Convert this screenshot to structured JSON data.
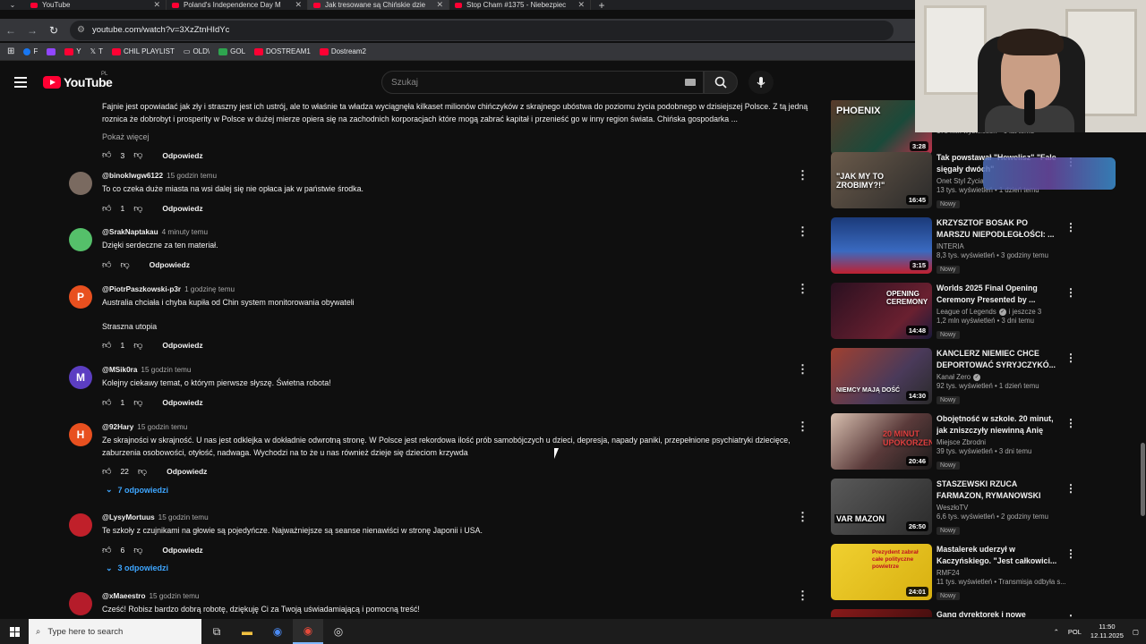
{
  "browser": {
    "tabs": [
      {
        "title": "YouTube",
        "active": false
      },
      {
        "title": "Poland's Independence Day M",
        "active": false
      },
      {
        "title": "Jak tresowane są Chińskie dzie",
        "active": true
      },
      {
        "title": "Stop Cham #1375 - Niebezpiec",
        "active": false
      }
    ],
    "url": "youtube.com/watch?v=3XzZtnHIdYc",
    "bookmarks": [
      {
        "label": "F",
        "color": "#1877f2"
      },
      {
        "label": "",
        "color": "#9146ff"
      },
      {
        "label": "Y",
        "color": "#ff0033"
      },
      {
        "label": "T",
        "color": "#ffffff"
      },
      {
        "label": "CHIL PLAYLIST",
        "color": "#ff0033"
      },
      {
        "label": "OLD\\",
        "color": "#cccccc"
      },
      {
        "label": "GOL",
        "color": "#2ea44f"
      },
      {
        "label": "DOSTREAM1",
        "color": "#ff0033"
      },
      {
        "label": "Dostream2",
        "color": "#ff0033"
      }
    ]
  },
  "youtube": {
    "logo_text": "YouTube",
    "country_code": "PL",
    "search_placeholder": "Szukaj"
  },
  "comments": {
    "prev_text": "Fajnie jest opowiadać jak zły i straszny jest ich ustrój, ale to właśnie ta władza wyciągnęła kilkaset milionów chińczyków z skrajnego ubóstwa do poziomu życia podobnego w dzisiejszej Polsce. Z tą jedną roznica że dobrobyt i prosperity w Polsce w dużej mierze opiera się na zachodnich korporacjach które mogą zabrać kapitał i przenieść go w inny region świata. Chińska gospodarka ...",
    "show_more": "Pokaż więcej",
    "prev_likes": "3",
    "reply_label": "Odpowiedz",
    "items": [
      {
        "author": "@binoklwgw6122",
        "time": "15 godzin temu",
        "text": "To co czeka duże miasta na wsi dalej się nie opłaca jak w państwie środka.",
        "likes": "1",
        "avatar_letter": "",
        "avatar_color": "#7a6a60"
      },
      {
        "author": "@SrakNaptakau",
        "time": "4 minuty temu",
        "text": "Dzięki serdeczne za ten materiał.",
        "likes": "",
        "avatar_letter": "",
        "avatar_color": "#55c06a"
      },
      {
        "author": "@PiotrPaszkowski-p3r",
        "time": "1 godzinę temu",
        "text": "Australia chciała i chyba kupiła od Chin system monitorowania obywateli",
        "text2": "Straszna utopia",
        "likes": "1",
        "avatar_letter": "P",
        "avatar_color": "#e8501f"
      },
      {
        "author": "@MSik0ra",
        "time": "15 godzin temu",
        "text": "Kolejny ciekawy temat, o którym pierwsze słyszę. Świetna robota!",
        "likes": "1",
        "avatar_letter": "M",
        "avatar_color": "#5c3ec2"
      },
      {
        "author": "@92Hary",
        "time": "15 godzin temu",
        "text": "Ze skrajności w skrajność. U nas jest odklejka w dokładnie odwrotną stronę. W Polsce jest rekordowa ilość prób samobójczych u dzieci, depresja, napady paniki, przepełnione psychiatryki dziecięce, zaburzenia osobowości, otyłość, nadwaga. Wychodzi na to że u nas również dzieje się dzieciom krzywda",
        "likes": "22",
        "avatar_letter": "H",
        "avatar_color": "#e8501f",
        "replies": "7 odpowiedzi"
      },
      {
        "author": "@LysyMortuus",
        "time": "15 godzin temu",
        "text": "Te szkoły z czujnikami na głowie są pojedyńcze. Najważniejsze są seanse nienawiści w stronę Japonii i USA.",
        "likes": "6",
        "avatar_letter": "",
        "avatar_color": "#c0202a",
        "replies": "3 odpowiedzi"
      },
      {
        "author": "@xMaeestro",
        "time": "15 godzin temu",
        "text": "Cześć! Robisz bardzo dobrą robotę, dziękuję Ci za Twoją uświadamiającą i pomocną treść!",
        "likes": "",
        "avatar_letter": "",
        "avatar_color": "#b51c2a"
      }
    ]
  },
  "sidebar": {
    "videos": [
      {
        "title": "",
        "channel": "",
        "meta": "175 mln wyświetleń • 6 lat temu",
        "duration": "3:28",
        "thumb_text": "PHOENIX",
        "thumb_color": "#3a2a22",
        "new": false
      },
      {
        "title": "Tak powstawał \"Hewelisz\" \"Fale sięgały dwóch\"",
        "channel": "Onet Styl Życia",
        "meta": "13 tys. wyświetleń • 1 dzień temu",
        "duration": "16:45",
        "thumb_text": "\"JAK MY TO ZROBIMY?!\"",
        "thumb_color": "#5a4a3a",
        "new": true
      },
      {
        "title": "KRZYSZTOF BOSAK PO MARSZU NIEPODLEGŁOŚCI: ...",
        "channel": "INTERIA",
        "meta": "8,3 tys. wyświetleń • 3 godziny temu",
        "duration": "3:15",
        "thumb_text": "",
        "thumb_color": "#2b4d8a",
        "new": true
      },
      {
        "title": "Worlds 2025 Final Opening Ceremony Presented by ...",
        "channel": "League of Legends",
        "channel_extra": "i jeszcze 3",
        "meta": "1,2 mln wyświetleń • 3 dni temu",
        "duration": "14:48",
        "thumb_text": "OPENING CEREMONY",
        "thumb_color": "#3a1b2a",
        "new": true,
        "verified": true
      },
      {
        "title": "KANCLERZ NIEMIEC CHCE DEPORTOWAĆ SYRYJCZYKÓ...",
        "channel": "Kanał Zero",
        "meta": "92 tys. wyświetleń • 1 dzień temu",
        "duration": "14:30",
        "thumb_text": "NIEMCY MAJĄ DOŚĆ",
        "thumb_color": "#8a3a2a",
        "new": true,
        "verified": true
      },
      {
        "title": "Obojętność w szkole. 20 minut, jak zniszczyły niewinną Anię",
        "channel": "Miejsce Zbrodni",
        "meta": "39 tys. wyświetleń • 3 dni temu",
        "duration": "20:46",
        "thumb_text": "20 MINUT UPOKORZENIA",
        "thumb_color": "#4a2a2a",
        "new": true
      },
      {
        "title": "STASZEWSKI RZUCA FARMAZON, RYMANOWSKI NI...",
        "channel": "WeszłoTV",
        "meta": "6,6 tys. wyświetleń • 2 godziny temu",
        "duration": "26:50",
        "thumb_text": "VAR MAZON",
        "thumb_color": "#3a3a3a",
        "new": true
      },
      {
        "title": "Mastalerek uderzył w Kaczyńskiego. \"Jest całkowici...",
        "channel": "RMF24",
        "meta": "11 tys. wyświetleń • Transmisja odbyła s...",
        "duration": "24:01",
        "thumb_text": "Prezydent zabrał całe polityczne powietrze",
        "thumb_color": "#d8c020",
        "new": true
      },
      {
        "title": "Gang dyrektorek i nowe",
        "channel": "",
        "meta": "",
        "duration": "",
        "thumb_text": "",
        "thumb_color": "#6a1a1a",
        "new": false
      }
    ]
  },
  "taskbar": {
    "search_placeholder": "Type here to search",
    "lang": "POL",
    "time": "11:50",
    "date": "12.11.2025"
  }
}
